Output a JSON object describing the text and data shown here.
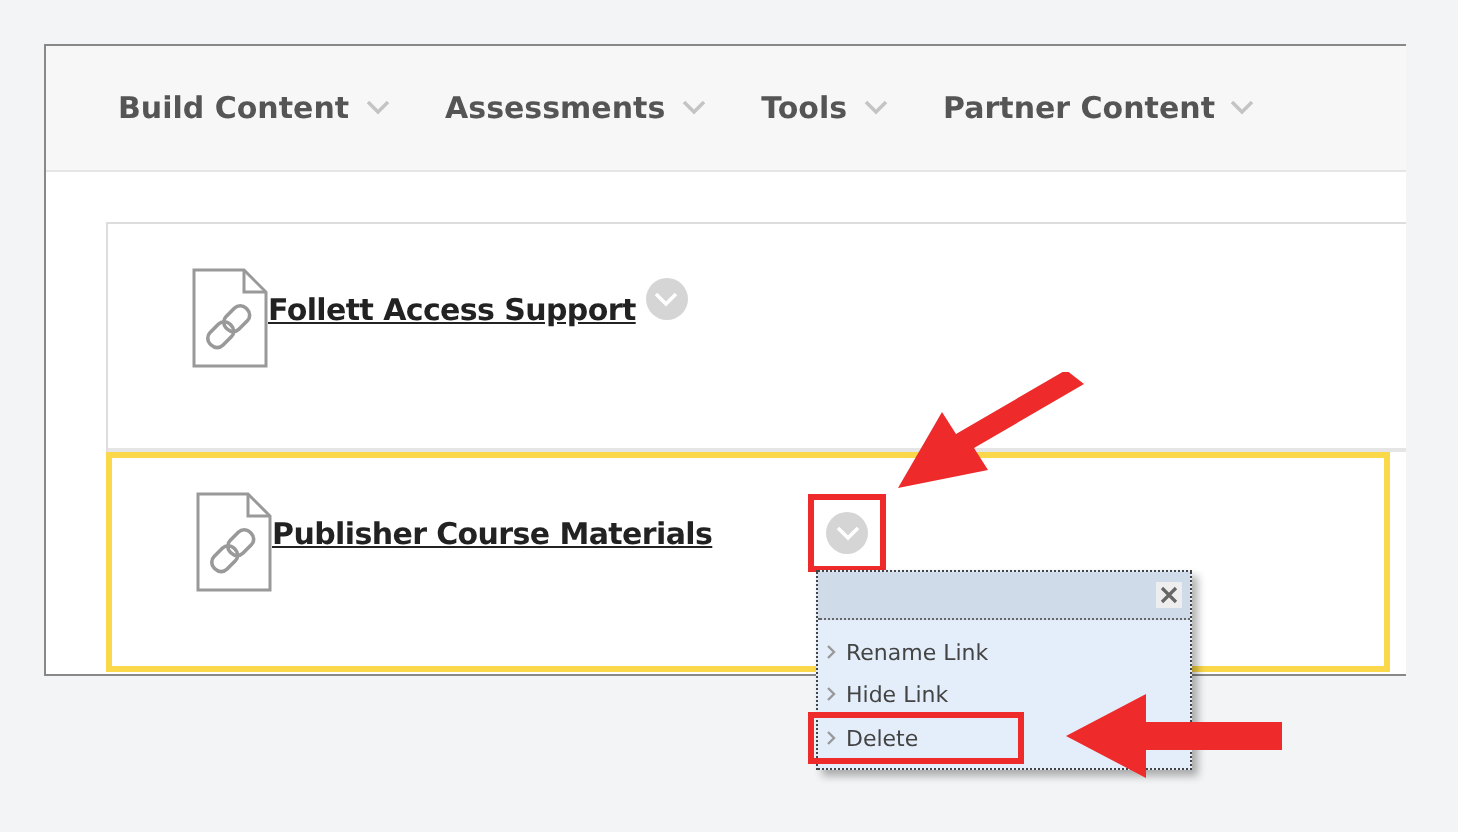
{
  "toolbar": [
    {
      "label": "Build Content"
    },
    {
      "label": "Assessments"
    },
    {
      "label": "Tools"
    },
    {
      "label": "Partner Content"
    }
  ],
  "items": [
    {
      "title": "Follett Access Support",
      "selected": false,
      "marked": false
    },
    {
      "title": "Publisher Course Materials",
      "selected": true,
      "marked": true
    }
  ],
  "menu": {
    "items": [
      {
        "label": "Rename Link",
        "marked": false
      },
      {
        "label": "Hide Link",
        "marked": false
      },
      {
        "label": "Delete",
        "marked": true
      }
    ]
  }
}
